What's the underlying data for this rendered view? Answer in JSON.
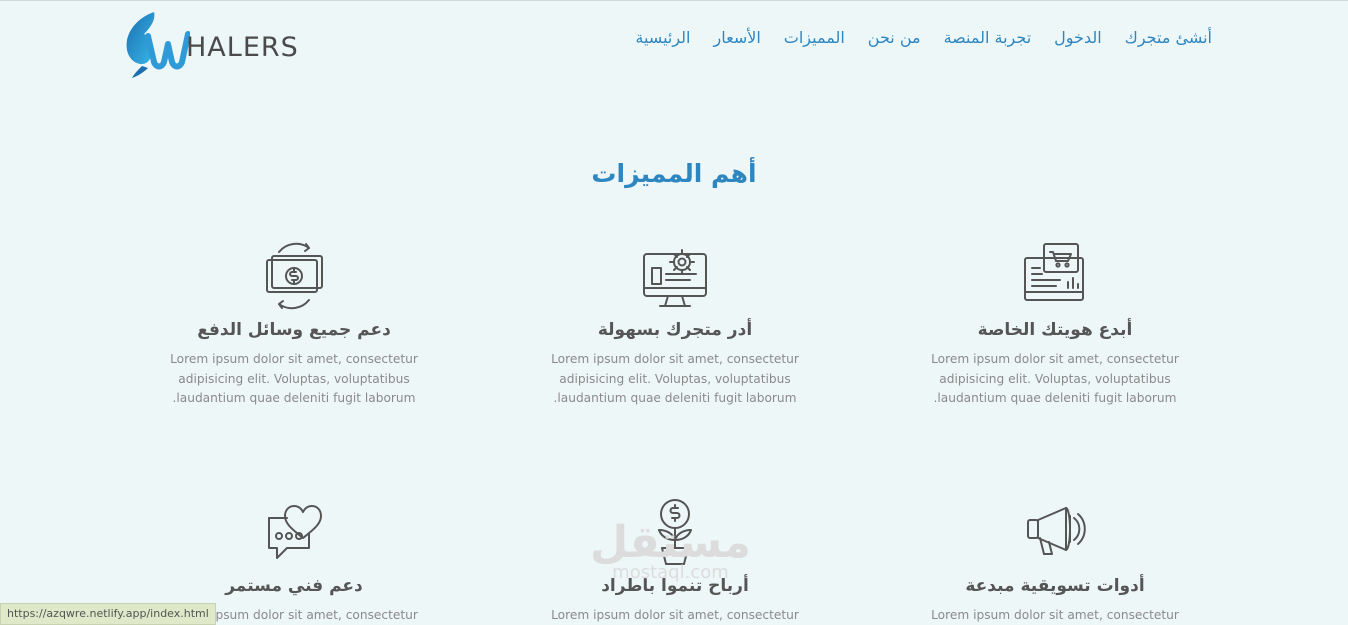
{
  "brand": {
    "logo_text": "HALERS"
  },
  "nav": {
    "items": [
      "الرئيسية",
      "الأسعار",
      "المميزات",
      "من نحن",
      "تجربة المنصة",
      "الدخول",
      "أنشئ متجرك"
    ]
  },
  "features": {
    "title": "أهم المميزات",
    "items": [
      {
        "title": "أبدع هويتك الخاصة",
        "text": "Lorem ipsum dolor sit amet, consectetur adipisicing elit. Voluptas, voluptatibus laudantium quae deleniti fugit laborum.",
        "icon": "store-screen-icon"
      },
      {
        "title": "أدر متجرك بسهولة",
        "text": "Lorem ipsum dolor sit amet, consectetur adipisicing elit. Voluptas, voluptatibus laudantium quae deleniti fugit laborum.",
        "icon": "monitor-gear-icon"
      },
      {
        "title": "دعم جميع وسائل الدفع",
        "text": "Lorem ipsum dolor sit amet, consectetur adipisicing elit. Voluptas, voluptatibus laudantium quae deleniti fugit laborum.",
        "icon": "money-exchange-icon"
      },
      {
        "title": "أدوات تسويقية مبدعة",
        "text": "Lorem ipsum dolor sit amet, consectetur adipisicing",
        "icon": "megaphone-icon"
      },
      {
        "title": "أرباح تنموا باطراد",
        "text": "Lorem ipsum dolor sit amet, consectetur adipisicing",
        "icon": "money-plant-icon"
      },
      {
        "title": "دعم فني مستمر",
        "text": "Lorem ipsum dolor sit amet, consectetur adipisicing",
        "icon": "heart-chat-icon"
      }
    ]
  },
  "watermark": {
    "main": "مستقل",
    "sub": "mostaql.com"
  },
  "status_bar": {
    "url": "https://azqwre.netlify.app/index.html"
  },
  "colors": {
    "accent": "#2e86c1",
    "background": "#eef7f8",
    "text": "#555555",
    "muted": "#8a8a8a"
  }
}
